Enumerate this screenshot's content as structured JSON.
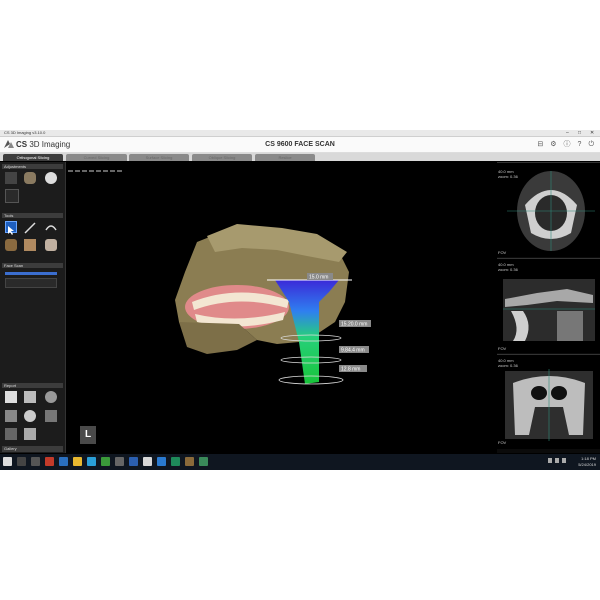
{
  "window": {
    "title": "CS 3D Imaging v3.10.0",
    "min_glyph": "–",
    "max_glyph": "□",
    "close_glyph": "✕"
  },
  "header": {
    "brand_bold": "CS",
    "brand_rest": " 3D Imaging",
    "scan_title": "CS 9600 FACE SCAN",
    "icons": [
      "print-icon",
      "settings-icon",
      "info-icon",
      "help-icon",
      "power-icon"
    ],
    "icon_glyphs": [
      "⊟",
      "⚙",
      "ⓘ",
      "?",
      "⏻"
    ]
  },
  "tabs": [
    {
      "label": "Orthogonal Slicing",
      "active": true
    },
    {
      "label": "Curved Slicing",
      "active": false
    },
    {
      "label": "Surface Slicing",
      "active": false
    },
    {
      "label": "Oblique Slicing",
      "active": false
    },
    {
      "label": "Reslice",
      "active": false
    }
  ],
  "left_panel": {
    "adjustments_label": "Adjustments",
    "tools_label": "Tools",
    "face_scan_label": "Face Scan",
    "report_label": "Report",
    "gallery_label": "Gallery"
  },
  "viewport": {
    "orientation_badge": "L",
    "measurements": [
      "15.0 mm",
      "15.20.0 mm",
      "9.84.4 mm",
      "12.8 mm"
    ]
  },
  "right_panel": {
    "panes": [
      {
        "top_left": "40.0 mm",
        "sub_left": "zoom: 0.36",
        "fov": "FOV"
      },
      {
        "top_left": "40.0 mm",
        "sub_left": "zoom: 0.36",
        "fov": "FOV"
      },
      {
        "top_left": "40.0 mm",
        "sub_left": "zoom: 0.36",
        "fov": "FOV"
      }
    ]
  },
  "taskbar": {
    "time": "1:18 PM",
    "date": "5/24/2019"
  },
  "colors": {
    "accent_blue": "#1e5fbf",
    "panel_dark": "#1c1c1c",
    "background": "#000000"
  }
}
